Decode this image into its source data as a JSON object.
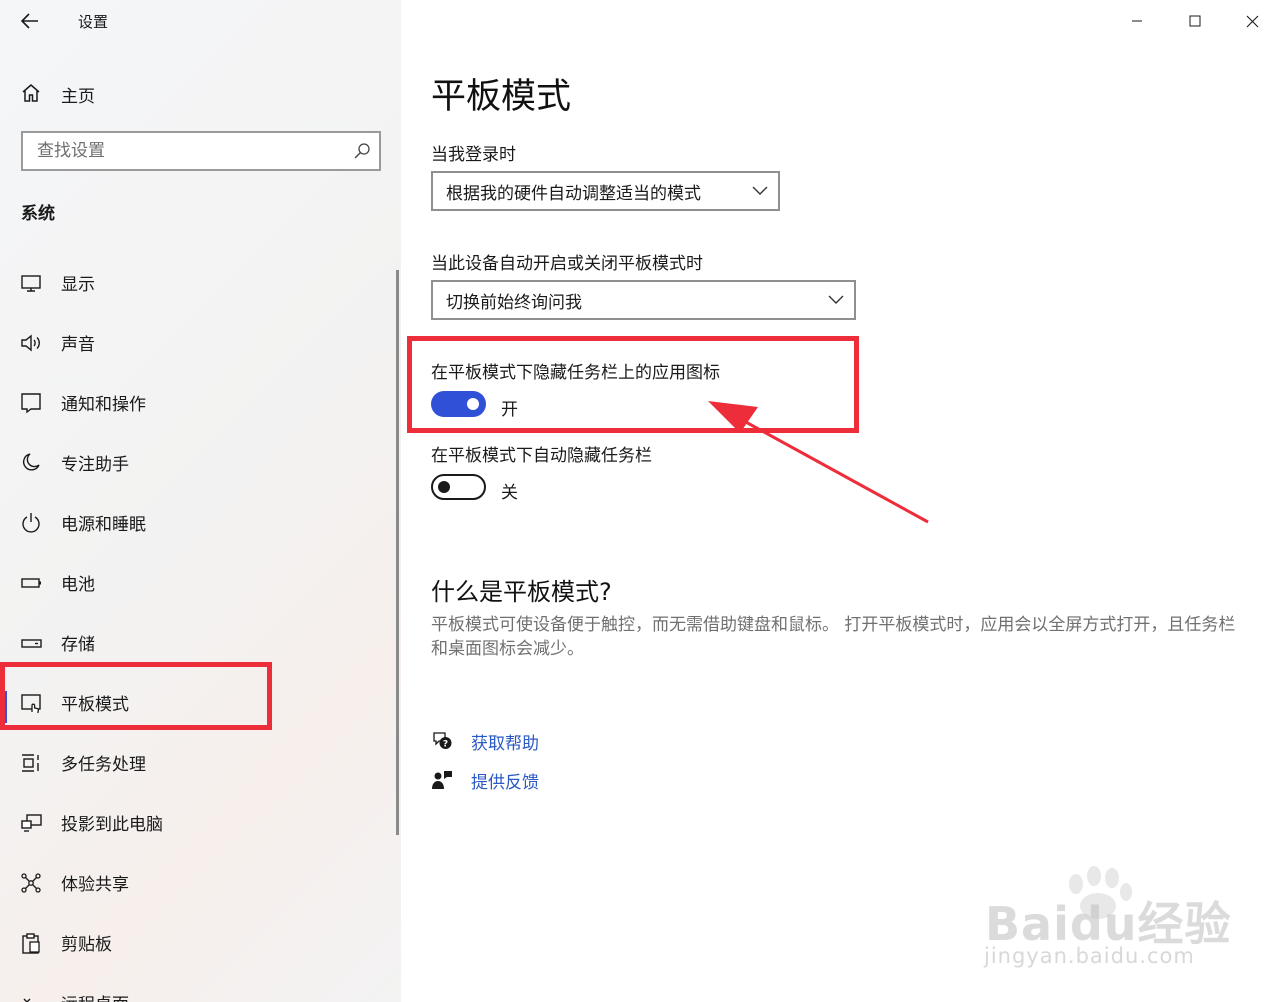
{
  "window": {
    "title": "设置",
    "minimize_glyph": "—",
    "maximize_glyph": "☐",
    "close_glyph": "✕"
  },
  "sidebar": {
    "home_label": "主页",
    "search_placeholder": "查找设置",
    "section": "系统",
    "items": [
      {
        "label": "显示",
        "icon": "monitor-icon"
      },
      {
        "label": "声音",
        "icon": "speaker-icon"
      },
      {
        "label": "通知和操作",
        "icon": "message-icon"
      },
      {
        "label": "专注助手",
        "icon": "moon-icon"
      },
      {
        "label": "电源和睡眠",
        "icon": "power-icon"
      },
      {
        "label": "电池",
        "icon": "battery-icon"
      },
      {
        "label": "存储",
        "icon": "storage-icon"
      },
      {
        "label": "平板模式",
        "icon": "tablet-mode-icon",
        "active": true
      },
      {
        "label": "多任务处理",
        "icon": "multitask-icon"
      },
      {
        "label": "投影到此电脑",
        "icon": "project-icon"
      },
      {
        "label": "体验共享",
        "icon": "share-icon"
      },
      {
        "label": "剪贴板",
        "icon": "clipboard-icon"
      },
      {
        "label": "远程桌面",
        "icon": "remote-desktop-icon"
      }
    ]
  },
  "main": {
    "title": "平板模式",
    "signin_label": "当我登录时",
    "signin_value": "根据我的硬件自动调整适当的模式",
    "switch_label": "当此设备自动开启或关闭平板模式时",
    "switch_value": "切换前始终询问我",
    "hide_icons_label": "在平板模式下隐藏任务栏上的应用图标",
    "hide_icons_state": "开",
    "hide_icons_on": true,
    "autohide_label": "在平板模式下自动隐藏任务栏",
    "autohide_state": "关",
    "autohide_on": false,
    "what_heading": "什么是平板模式?",
    "what_desc": "平板模式可使设备便于触控，而无需借助键盘和鼠标。 打开平板模式时，应用会以全屏方式打开，且任务栏和桌面图标会减少。",
    "help_link": "获取帮助",
    "feedback_link": "提供反馈"
  },
  "watermark": {
    "brand": "Baidu经验",
    "url": "jingyan.baidu.com"
  },
  "colors": {
    "accent": "#3050d8",
    "highlight": "#ee2d3a",
    "link": "#2a58c4"
  }
}
